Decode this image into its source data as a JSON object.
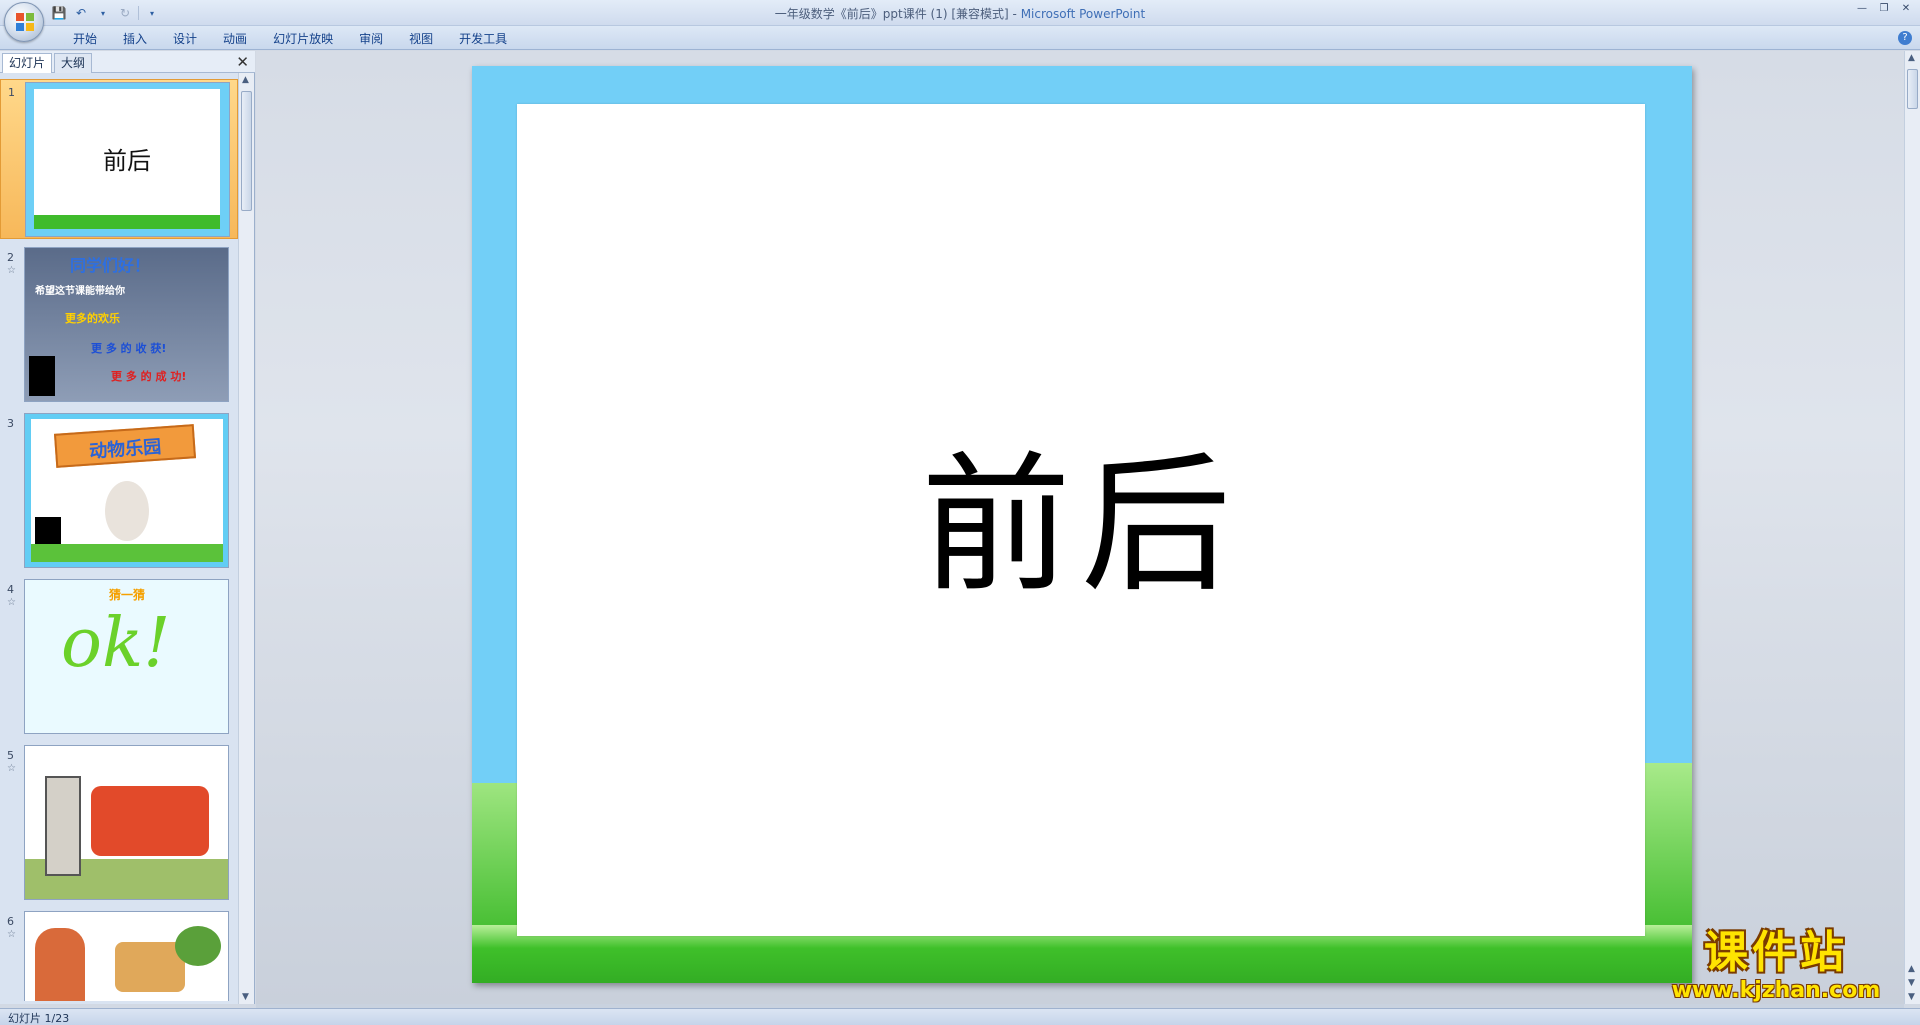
{
  "window": {
    "title_doc": "一年级数学《前后》ppt课件 (1) [兼容模式]",
    "title_sep": " - ",
    "title_app": "Microsoft PowerPoint"
  },
  "ribbon": {
    "tabs": [
      "开始",
      "插入",
      "设计",
      "动画",
      "幻灯片放映",
      "审阅",
      "视图",
      "开发工具"
    ]
  },
  "left_panel": {
    "tabs": [
      "幻灯片",
      "大纲"
    ],
    "active_tab": "幻灯片",
    "slides": [
      {
        "num": "1",
        "text": "前后"
      },
      {
        "num": "2",
        "heading": "同学们好！",
        "lines": [
          "希望这节课能带给你",
          "更多的欢乐",
          "更 多 的 收 获!",
          "更 多 的 成 功!"
        ]
      },
      {
        "num": "3",
        "heading": "动物乐园"
      },
      {
        "num": "4",
        "heading": "猜一猜",
        "text": "ok!"
      },
      {
        "num": "5"
      },
      {
        "num": "6"
      }
    ]
  },
  "slide": {
    "title": "前后"
  },
  "watermark": {
    "main": "课件站",
    "sub": "www.kjzhan.com"
  },
  "status": {
    "slide_indicator": "幻灯片 1/23"
  },
  "colors": {
    "slide_frame": "#72cff7",
    "grass": "#3fbb2c",
    "selected_thumb": "#f7b85a",
    "accent": "#15428b"
  }
}
